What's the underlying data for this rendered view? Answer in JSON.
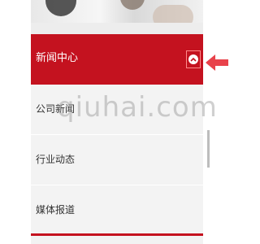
{
  "menu": {
    "header_label": "新闻中心",
    "items": [
      {
        "label": "公司新闻"
      },
      {
        "label": "行业动态"
      },
      {
        "label": "媒体报道"
      }
    ]
  },
  "watermark": "qiuhai.com",
  "colors": {
    "accent": "#c4121f",
    "arrow": "#e8424b"
  },
  "icons": {
    "toggle": "chevron-up-icon",
    "pointer": "arrow-left-icon"
  }
}
